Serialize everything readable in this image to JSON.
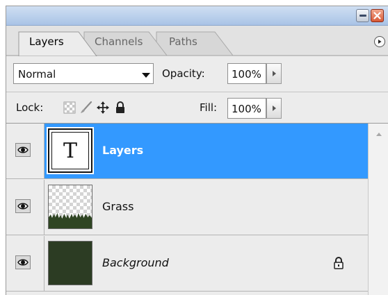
{
  "panel": {
    "tabs": [
      {
        "label": "Layers",
        "active": true
      },
      {
        "label": "Channels",
        "active": false
      },
      {
        "label": "Paths",
        "active": false
      }
    ]
  },
  "options": {
    "blend_mode": "Normal",
    "opacity_label": "Opacity:",
    "opacity_value": "100%",
    "lock_label": "Lock:",
    "fill_label": "Fill:",
    "fill_value": "100%"
  },
  "layers": [
    {
      "name": "Layers",
      "type": "text",
      "thumb_glyph": "T",
      "selected": true,
      "visible": true,
      "locked": false
    },
    {
      "name": "Grass",
      "type": "image",
      "selected": false,
      "visible": true,
      "locked": false
    },
    {
      "name": "Background",
      "type": "background",
      "selected": false,
      "visible": true,
      "locked": true
    }
  ],
  "colors": {
    "selection": "#3399ff",
    "titlebar": "#b9cfea",
    "panel": "#ececec",
    "background_fill": "#2c3c23",
    "grass": "#2f4523"
  },
  "icons": {
    "visibility": "eye-icon",
    "lock_transparent": "checkerboard-icon",
    "lock_image": "brush-icon",
    "lock_position": "move-icon",
    "lock_all": "padlock-icon",
    "panel_menu": "play-circle-icon"
  }
}
